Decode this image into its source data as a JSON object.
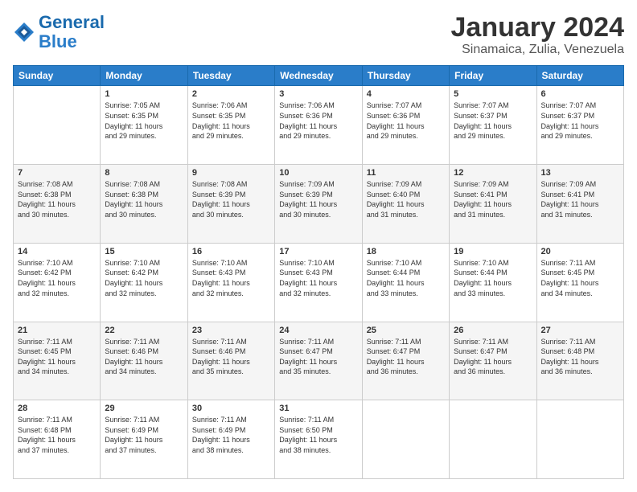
{
  "logo": {
    "line1": "General",
    "line2": "Blue"
  },
  "title": "January 2024",
  "subtitle": "Sinamaica, Zulia, Venezuela",
  "days_header": [
    "Sunday",
    "Monday",
    "Tuesday",
    "Wednesday",
    "Thursday",
    "Friday",
    "Saturday"
  ],
  "weeks": [
    [
      {
        "num": "",
        "info": ""
      },
      {
        "num": "1",
        "info": "Sunrise: 7:05 AM\nSunset: 6:35 PM\nDaylight: 11 hours\nand 29 minutes."
      },
      {
        "num": "2",
        "info": "Sunrise: 7:06 AM\nSunset: 6:35 PM\nDaylight: 11 hours\nand 29 minutes."
      },
      {
        "num": "3",
        "info": "Sunrise: 7:06 AM\nSunset: 6:36 PM\nDaylight: 11 hours\nand 29 minutes."
      },
      {
        "num": "4",
        "info": "Sunrise: 7:07 AM\nSunset: 6:36 PM\nDaylight: 11 hours\nand 29 minutes."
      },
      {
        "num": "5",
        "info": "Sunrise: 7:07 AM\nSunset: 6:37 PM\nDaylight: 11 hours\nand 29 minutes."
      },
      {
        "num": "6",
        "info": "Sunrise: 7:07 AM\nSunset: 6:37 PM\nDaylight: 11 hours\nand 29 minutes."
      }
    ],
    [
      {
        "num": "7",
        "info": "Sunrise: 7:08 AM\nSunset: 6:38 PM\nDaylight: 11 hours\nand 30 minutes."
      },
      {
        "num": "8",
        "info": "Sunrise: 7:08 AM\nSunset: 6:38 PM\nDaylight: 11 hours\nand 30 minutes."
      },
      {
        "num": "9",
        "info": "Sunrise: 7:08 AM\nSunset: 6:39 PM\nDaylight: 11 hours\nand 30 minutes."
      },
      {
        "num": "10",
        "info": "Sunrise: 7:09 AM\nSunset: 6:39 PM\nDaylight: 11 hours\nand 30 minutes."
      },
      {
        "num": "11",
        "info": "Sunrise: 7:09 AM\nSunset: 6:40 PM\nDaylight: 11 hours\nand 31 minutes."
      },
      {
        "num": "12",
        "info": "Sunrise: 7:09 AM\nSunset: 6:41 PM\nDaylight: 11 hours\nand 31 minutes."
      },
      {
        "num": "13",
        "info": "Sunrise: 7:09 AM\nSunset: 6:41 PM\nDaylight: 11 hours\nand 31 minutes."
      }
    ],
    [
      {
        "num": "14",
        "info": "Sunrise: 7:10 AM\nSunset: 6:42 PM\nDaylight: 11 hours\nand 32 minutes."
      },
      {
        "num": "15",
        "info": "Sunrise: 7:10 AM\nSunset: 6:42 PM\nDaylight: 11 hours\nand 32 minutes."
      },
      {
        "num": "16",
        "info": "Sunrise: 7:10 AM\nSunset: 6:43 PM\nDaylight: 11 hours\nand 32 minutes."
      },
      {
        "num": "17",
        "info": "Sunrise: 7:10 AM\nSunset: 6:43 PM\nDaylight: 11 hours\nand 32 minutes."
      },
      {
        "num": "18",
        "info": "Sunrise: 7:10 AM\nSunset: 6:44 PM\nDaylight: 11 hours\nand 33 minutes."
      },
      {
        "num": "19",
        "info": "Sunrise: 7:10 AM\nSunset: 6:44 PM\nDaylight: 11 hours\nand 33 minutes."
      },
      {
        "num": "20",
        "info": "Sunrise: 7:11 AM\nSunset: 6:45 PM\nDaylight: 11 hours\nand 34 minutes."
      }
    ],
    [
      {
        "num": "21",
        "info": "Sunrise: 7:11 AM\nSunset: 6:45 PM\nDaylight: 11 hours\nand 34 minutes."
      },
      {
        "num": "22",
        "info": "Sunrise: 7:11 AM\nSunset: 6:46 PM\nDaylight: 11 hours\nand 34 minutes."
      },
      {
        "num": "23",
        "info": "Sunrise: 7:11 AM\nSunset: 6:46 PM\nDaylight: 11 hours\nand 35 minutes."
      },
      {
        "num": "24",
        "info": "Sunrise: 7:11 AM\nSunset: 6:47 PM\nDaylight: 11 hours\nand 35 minutes."
      },
      {
        "num": "25",
        "info": "Sunrise: 7:11 AM\nSunset: 6:47 PM\nDaylight: 11 hours\nand 36 minutes."
      },
      {
        "num": "26",
        "info": "Sunrise: 7:11 AM\nSunset: 6:47 PM\nDaylight: 11 hours\nand 36 minutes."
      },
      {
        "num": "27",
        "info": "Sunrise: 7:11 AM\nSunset: 6:48 PM\nDaylight: 11 hours\nand 36 minutes."
      }
    ],
    [
      {
        "num": "28",
        "info": "Sunrise: 7:11 AM\nSunset: 6:48 PM\nDaylight: 11 hours\nand 37 minutes."
      },
      {
        "num": "29",
        "info": "Sunrise: 7:11 AM\nSunset: 6:49 PM\nDaylight: 11 hours\nand 37 minutes."
      },
      {
        "num": "30",
        "info": "Sunrise: 7:11 AM\nSunset: 6:49 PM\nDaylight: 11 hours\nand 38 minutes."
      },
      {
        "num": "31",
        "info": "Sunrise: 7:11 AM\nSunset: 6:50 PM\nDaylight: 11 hours\nand 38 minutes."
      },
      {
        "num": "",
        "info": ""
      },
      {
        "num": "",
        "info": ""
      },
      {
        "num": "",
        "info": ""
      }
    ]
  ]
}
